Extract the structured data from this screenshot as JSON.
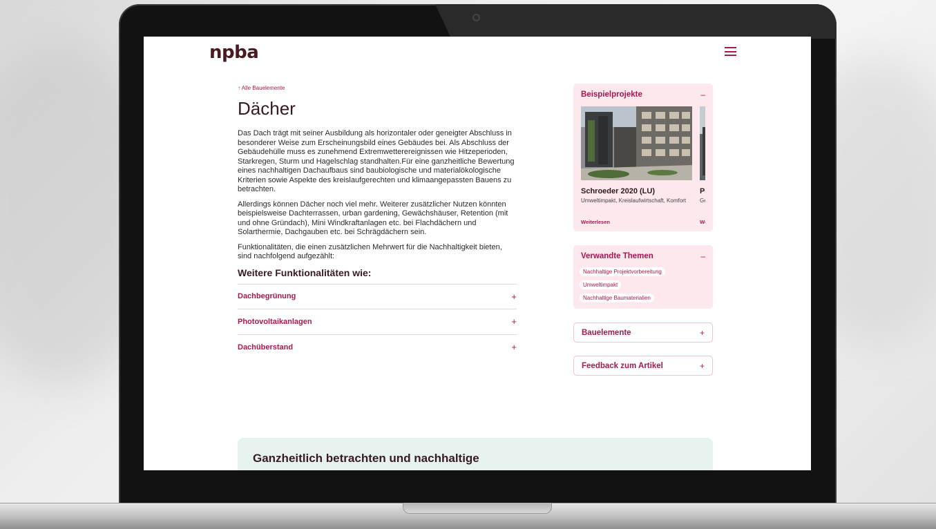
{
  "site": {
    "logo": "npba"
  },
  "breadcrumb": {
    "back_label": "↑ Alle Bauelemente"
  },
  "article": {
    "title": "Dächer",
    "paragraphs": [
      "Das Dach trägt mit seiner Ausbildung als horizontaler oder geneigter Abschluss in besonderer Weise zum Erscheinungsbild eines Gebäudes bei. Als Abschluss der Gebäudehülle muss es zunehmend Extremwetterereignissen wie Hitzeperioden, Starkregen, Sturm und Hagelschlag standhalten.Für eine ganzheitliche Bewertung eines nachhaltigen Dachaufbaus sind baubiologische und materialökologische Kriterien sowie Aspekte des kreislaufgerechten und klimaangepassten Bauens zu betrachten.",
      "Allerdings können Dächer noch viel mehr. Weiterer zusätzlicher Nutzen könnten beispielsweise  Dachterrassen, urban gardening, Gewächshäuser, Retention (mit und ohne Gründach), Mini Windkraftanlagen etc. bei Flachdächern und Solarthermie, Dachgauben etc. bei Schrägdächern sein.",
      "Funktionalitäten, die einen zusätzlichen Mehrwert für die Nachhaltigkeit bieten, sind nachfolgend aufgezählt:"
    ],
    "subheading": "Weitere Funktionalitäten wie:",
    "accordion": [
      {
        "label": "Dachbegrünung",
        "icon": "+"
      },
      {
        "label": "Photovoltaikanlagen",
        "icon": "+"
      },
      {
        "label": "Dachüberstand",
        "icon": "+"
      }
    ]
  },
  "sidebar": {
    "projects_card": {
      "title": "Beispielprojekte",
      "toggle": "–",
      "items": [
        {
          "title": "Schroeder 2020 (LU)",
          "tags": "Umweltimpakt, Kreislaufwirtschaft, Komfort",
          "link": "Weiterlesen"
        },
        {
          "title": "Petit",
          "tags": "Gesu Umw",
          "link": "Weite"
        }
      ]
    },
    "related_card": {
      "title": "Verwandte Themen",
      "toggle": "–",
      "chips": [
        "Nachhaltige Projektvorbereitung",
        "Umweltimpakt",
        "Nachhaltige Baumaterialien"
      ]
    },
    "bauelemente": {
      "title": "Bauelemente",
      "toggle": "+"
    },
    "feedback": {
      "title": "Feedback zum Artikel",
      "toggle": "+"
    }
  },
  "bottom_box": {
    "title": "Ganzheitlich betrachten und nachhaltige"
  },
  "colors": {
    "accent": "#a8184f",
    "dark": "#3a1a22",
    "pink_bg": "#fde8ee",
    "mint_bg": "#e7f3ef"
  },
  "icons": [
    "menu-icon",
    "arrow-up-icon",
    "plus-icon",
    "minus-icon",
    "camera-icon"
  ]
}
